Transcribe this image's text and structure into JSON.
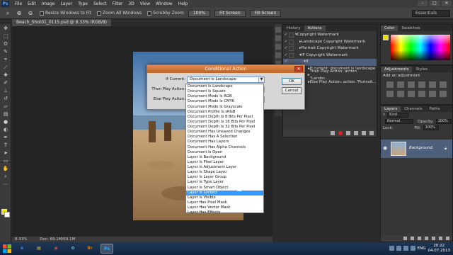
{
  "menubar": {
    "logo": "Ps",
    "items": [
      "File",
      "Edit",
      "Image",
      "Layer",
      "Type",
      "Select",
      "Filter",
      "3D",
      "View",
      "Window",
      "Help"
    ]
  },
  "window_controls": {
    "minimize": "–",
    "maximize": "□",
    "close": "✕"
  },
  "options_bar": {
    "resize_label": "Resize Windows to Fit",
    "zoom_all_label": "Zoom All Windows",
    "scrubby_label": "Scrubby Zoom",
    "zoom_value": "100%",
    "fit_screen": "Fit Screen",
    "fill_screen": "Fill Screen",
    "workspace": "Essentials"
  },
  "document": {
    "tab_title": "Beach_Shot01_0115.psd @ 8.33% (RGB/8)",
    "zoom": "8.33%",
    "doc_size": "Doc: 69.1M/69.1M"
  },
  "history_actions_panel": {
    "tabs": [
      "History",
      "Actions"
    ],
    "active_tab": "Actions",
    "rows": [
      {
        "label": "Copyright Watermark",
        "indent": 0,
        "expanded": true,
        "selected": false
      },
      {
        "label": "Landscape Copyright Watermark",
        "indent": 1,
        "expanded": false,
        "selected": false
      },
      {
        "label": "Portrait Copyright Watermark",
        "indent": 1,
        "expanded": false,
        "selected": false
      },
      {
        "label": "IF Copyright Watermark",
        "indent": 1,
        "expanded": true,
        "selected": false
      },
      {
        "label": "If",
        "indent": 2,
        "expanded": true,
        "selected": true
      },
      {
        "label": "If current: document is landscape",
        "indent": 3,
        "expanded": false,
        "selected": false
      },
      {
        "label": "Then Play Action: action \"Landsc...",
        "indent": 3,
        "expanded": false,
        "selected": false
      },
      {
        "label": "Else Play Action: action \"Portrait...",
        "indent": 3,
        "expanded": false,
        "selected": false
      }
    ]
  },
  "color_panel": {
    "tabs": [
      "Color",
      "Swatches"
    ],
    "foreground": "#f2e100",
    "background": "#ffffff"
  },
  "adjustments_panel": {
    "tabs": [
      "Adjustments",
      "Styles"
    ],
    "heading": "Add an adjustment"
  },
  "layers_panel": {
    "tabs": [
      "Layers",
      "Channels",
      "Paths"
    ],
    "kind": "Kind",
    "blend_mode": "Normal",
    "opacity_label": "Opacity:",
    "opacity": "100%",
    "lock_label": "Lock:",
    "fill_label": "Fill:",
    "fill": "100%",
    "layer_name": "Background"
  },
  "dialog": {
    "title": "Conditional Action",
    "if_current_label": "If Current:",
    "if_current_value": "Document Is Landscape",
    "then_label": "Then Play Action:",
    "else_label": "Else Play Action:",
    "ok": "OK",
    "cancel": "Cancel"
  },
  "dropdown": {
    "highlighted_index": 21,
    "items": [
      "Document Is Landscape",
      "Document Is Square",
      "Document Mode Is RGB",
      "Document Mode Is CMYK",
      "Document Mode Is Grayscale",
      "Document Profile Is sRGB",
      "Document Depth Is 8 Bits Per Pixel",
      "Document Depth Is 16 Bits Per Pixel",
      "Document Depth Is 32 Bits Per Pixel",
      "Document Has Unsaved Changes",
      "Document Has A Selection",
      "Document Has Layers",
      "Document Has Alpha Channels",
      "Document Is Open",
      "Layer Is Background",
      "Layer Is Pixel Layer",
      "Layer Is Adjustment Layer",
      "Layer Is Shape Layer",
      "Layer Is Layer Group",
      "Layer Is Type Layer",
      "Layer Is Smart Object",
      "Layer Is Locked",
      "Layer Is Visible",
      "Layer Has Pixel Mask",
      "Layer Has Vector Mask",
      "Layer Has Effects"
    ]
  },
  "taskbar": {
    "apps": [
      {
        "name": "internet-explorer",
        "glyph": "e",
        "color": "#3a8de0",
        "active": false
      },
      {
        "name": "file-explorer",
        "glyph": "▤",
        "color": "#e8c040",
        "active": false
      },
      {
        "name": "chrome",
        "glyph": "◉",
        "color": "#e04a3a",
        "active": false
      },
      {
        "name": "windows-media",
        "glyph": "✿",
        "color": "#6ac0e8",
        "active": false
      },
      {
        "name": "bridge",
        "glyph": "Br",
        "color": "#c07010",
        "active": false
      },
      {
        "name": "photoshop",
        "glyph": "Ps",
        "color": "#31a8ff",
        "active": true
      }
    ],
    "language": "ENG",
    "time": "20:22",
    "date": "04.07.2013"
  }
}
